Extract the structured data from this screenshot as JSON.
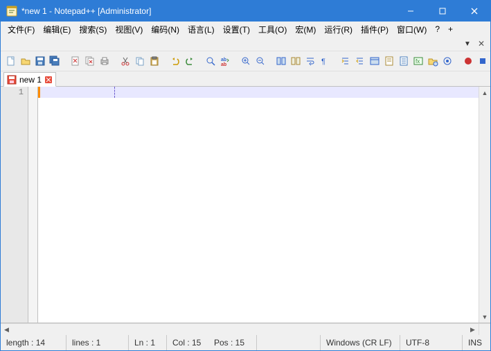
{
  "title": "*new 1 - Notepad++ [Administrator]",
  "menus": {
    "file": "文件(F)",
    "edit": "编辑(E)",
    "search": "搜索(S)",
    "view": "视图(V)",
    "encoding": "编码(N)",
    "language": "语言(L)",
    "settings": "设置(T)",
    "tools": "工具(O)",
    "macro": "宏(M)",
    "run": "运行(R)",
    "plugins": "插件(P)",
    "window": "窗口(W)",
    "help": "?",
    "plus": "+"
  },
  "tab": {
    "label": "new 1"
  },
  "gutter": {
    "line1": "1"
  },
  "status": {
    "length": "length : 14",
    "lines": "lines : 1",
    "ln": "Ln : 1",
    "col": "Col : 15",
    "pos": "Pos : 15",
    "eol": "Windows (CR LF)",
    "enc": "UTF-8",
    "ins": "INS"
  }
}
